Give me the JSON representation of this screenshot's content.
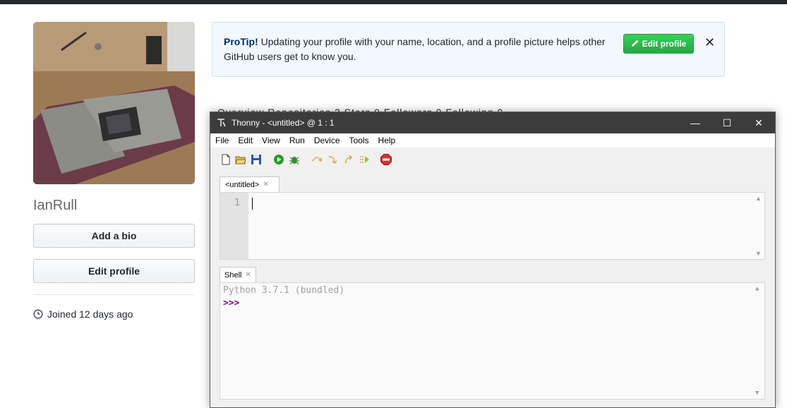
{
  "profile": {
    "username": "IanRull",
    "add_bio_label": "Add a bio",
    "edit_profile_label": "Edit profile",
    "joined_text": "Joined 12 days ago"
  },
  "protip": {
    "lead": "ProTip!",
    "text": " Updating your profile with your name, location, and a profile picture helps other GitHub users get to know you.",
    "button_label": "Edit profile",
    "close_glyph": "✕"
  },
  "tabs_peek": "Overview   Repositories 2   Stars 0   Followers 0   Following 0",
  "thonny": {
    "title": "Thonny  -  <untitled>  @  1 : 1",
    "window_controls": {
      "minimize": "—",
      "maximize": "☐",
      "close": "✕"
    },
    "menu": [
      "File",
      "Edit",
      "View",
      "Run",
      "Device",
      "Tools",
      "Help"
    ],
    "toolbar_icons": [
      "new-file-icon",
      "open-file-icon",
      "save-icon",
      "run-icon",
      "debug-icon",
      "step-over-icon",
      "step-into-icon",
      "step-out-icon",
      "resume-icon",
      "stop-icon"
    ],
    "editor_tab": "<untitled>",
    "line_number": "1",
    "shell_tab": "Shell",
    "shell_banner": "Python 3.7.1 (bundled)",
    "shell_prompt": ">>>"
  },
  "colors": {
    "github_green": "#28a745",
    "thonny_titlebar": "#3c3c3c",
    "stop_red": "#d9302c",
    "prompt_purple": "#7a0a9a"
  }
}
